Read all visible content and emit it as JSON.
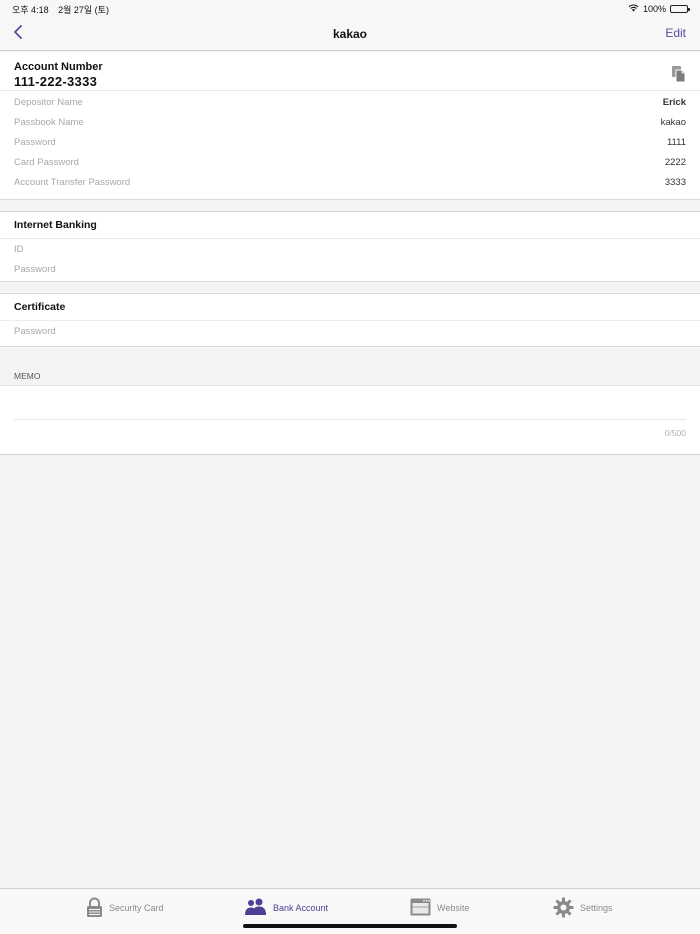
{
  "status_bar": {
    "time": "오후 4:18",
    "date": "2월 27일 (토)",
    "battery": "100%"
  },
  "nav": {
    "title": "kakao",
    "edit_label": "Edit",
    "back_icon": "chevron-left-icon"
  },
  "account": {
    "label": "Account Number",
    "number": "111-222-3333",
    "copy_icon": "copy-icon",
    "rows": [
      {
        "label": "Depositor Name",
        "value": "Erick"
      },
      {
        "label": "Passbook Name",
        "value": "kakao"
      },
      {
        "label": "Password",
        "value": "1111"
      },
      {
        "label": "Card Password",
        "value": "2222"
      },
      {
        "label": "Account Transfer Password",
        "value": "3333"
      }
    ]
  },
  "internet_banking": {
    "title": "Internet Banking",
    "rows": [
      {
        "label": "ID",
        "value": ""
      },
      {
        "label": "Password",
        "value": ""
      }
    ]
  },
  "certificate": {
    "title": "Certificate",
    "rows": [
      {
        "label": "Password",
        "value": ""
      }
    ]
  },
  "memo": {
    "label": "MEMO",
    "value": "",
    "count": "0/500"
  },
  "tabs": [
    {
      "label": "Security Card",
      "icon": "lock-icon",
      "active": false
    },
    {
      "label": "Bank Account",
      "icon": "people-icon",
      "active": true
    },
    {
      "label": "Website",
      "icon": "browser-window-icon",
      "active": false
    },
    {
      "label": "Settings",
      "icon": "gear-icon",
      "active": false
    }
  ],
  "colors": {
    "accent": "#4d3f93",
    "inactive": "#8a8a8a"
  }
}
